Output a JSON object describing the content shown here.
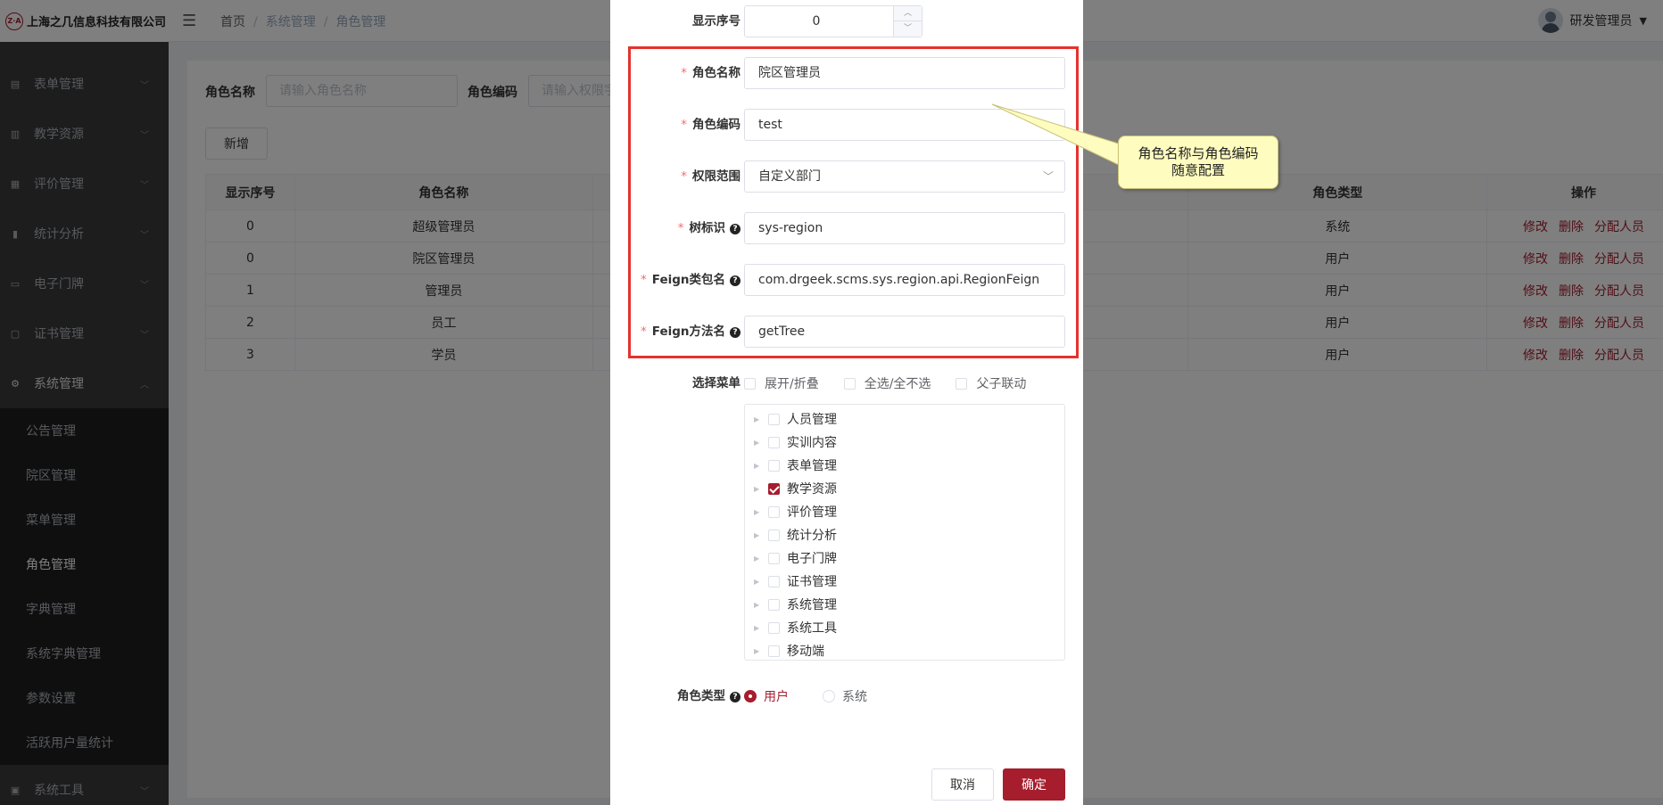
{
  "header": {
    "company": "上海之几信息科技有限公司",
    "logo_text": "Z·A",
    "breadcrumb": [
      "首页",
      "系统管理",
      "角色管理"
    ],
    "user_name": "研发管理员"
  },
  "sidebar": {
    "items": [
      {
        "label": "表单管理",
        "icon": "form-icon"
      },
      {
        "label": "教学资源",
        "icon": "book-icon"
      },
      {
        "label": "评价管理",
        "icon": "evaluation-icon"
      },
      {
        "label": "统计分析",
        "icon": "chart-icon"
      },
      {
        "label": "电子门牌",
        "icon": "monitor-icon"
      },
      {
        "label": "证书管理",
        "icon": "briefcase-icon"
      },
      {
        "label": "系统管理",
        "icon": "gear-icon"
      }
    ],
    "submenu": [
      "公告管理",
      "院区管理",
      "菜单管理",
      "角色管理",
      "字典管理",
      "系统字典管理",
      "参数设置",
      "活跃用户量统计"
    ],
    "active_submenu": "角色管理",
    "bottom_item": {
      "label": "系统工具",
      "icon": "toolbox-icon"
    }
  },
  "search": {
    "role_name_label": "角色名称",
    "role_name_placeholder": "请输入角色名称",
    "role_code_label": "角色编码",
    "role_code_placeholder": "请输入权限字"
  },
  "add_button": "新增",
  "table": {
    "headers": [
      "显示序号",
      "角色名称",
      "角色类型",
      "操作"
    ],
    "rows": [
      {
        "order": "0",
        "name": "超级管理员",
        "type": "系统"
      },
      {
        "order": "0",
        "name": "院区管理员",
        "type": "用户"
      },
      {
        "order": "1",
        "name": "管理员",
        "type": "用户"
      },
      {
        "order": "2",
        "name": "员工",
        "type": "用户"
      },
      {
        "order": "3",
        "name": "学员",
        "type": "用户"
      }
    ],
    "actions": [
      "修改",
      "删除",
      "分配人员"
    ]
  },
  "dialog": {
    "order_label": "显示序号",
    "order_value": "0",
    "role_name_label": "角色名称",
    "role_name_value": "院区管理员",
    "role_code_label": "角色编码",
    "role_code_value": "test",
    "scope_label": "权限范围",
    "scope_value": "自定义部门",
    "tree_id_label": "树标识",
    "tree_id_value": "sys-region",
    "feign_pkg_label": "Feign类包名",
    "feign_pkg_value": "com.drgeek.scms.sys.region.api.RegionFeign",
    "feign_method_label": "Feign方法名",
    "feign_method_value": "getTree",
    "menu_label": "选择菜单",
    "menu_options": [
      "展开/折叠",
      "全选/全不选",
      "父子联动"
    ],
    "tree": [
      {
        "label": "人员管理",
        "checked": false
      },
      {
        "label": "实训内容",
        "checked": false
      },
      {
        "label": "表单管理",
        "checked": false
      },
      {
        "label": "教学资源",
        "checked": true
      },
      {
        "label": "评价管理",
        "checked": false
      },
      {
        "label": "统计分析",
        "checked": false
      },
      {
        "label": "电子门牌",
        "checked": false
      },
      {
        "label": "证书管理",
        "checked": false
      },
      {
        "label": "系统管理",
        "checked": false
      },
      {
        "label": "系统工具",
        "checked": false
      },
      {
        "label": "移动端",
        "checked": false
      }
    ],
    "role_type_label": "角色类型",
    "role_type_options": [
      "用户",
      "系统"
    ],
    "role_type_selected": "用户",
    "cancel_label": "取消",
    "confirm_label": "确定"
  },
  "callout": {
    "line1": "角色名称与角色编码",
    "line2": "随意配置"
  },
  "colors": {
    "accent": "#a61d2d",
    "highlight_border": "#e5322d",
    "callout_bg": "#fefcbf"
  }
}
